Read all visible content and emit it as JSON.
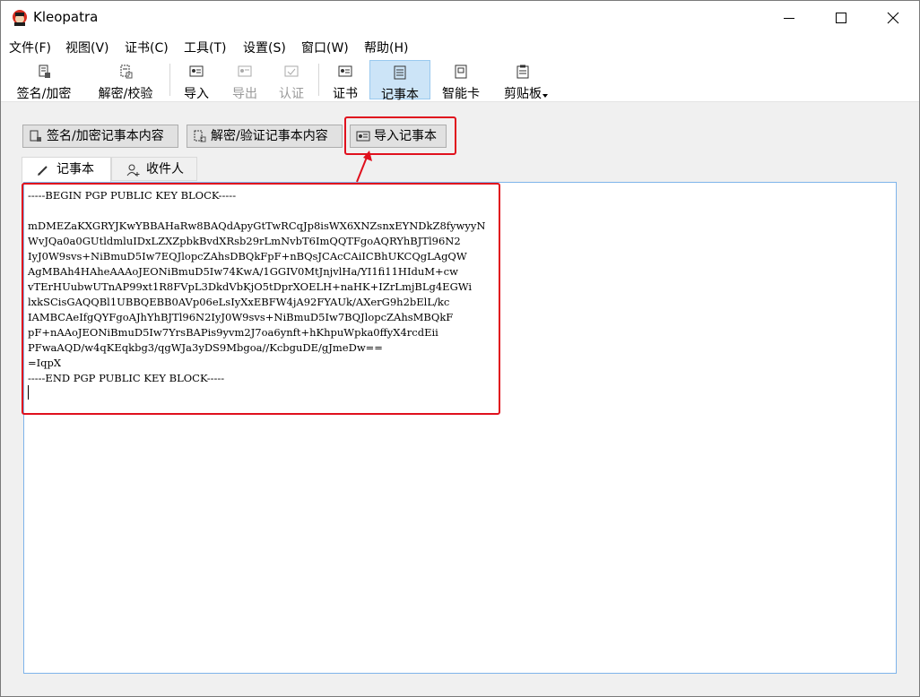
{
  "window": {
    "title": "Kleopatra",
    "controls": {
      "minimize": "minimize-icon",
      "maximize": "maximize-icon",
      "close": "close-icon"
    }
  },
  "menu": [
    "文件(F)",
    "视图(V)",
    "证书(C)",
    "工具(T)",
    "设置(S)",
    "窗口(W)",
    "帮助(H)"
  ],
  "toolbar": {
    "sign_encrypt": "签名/加密",
    "decrypt_verify": "解密/校验",
    "import": "导入",
    "export": "导出",
    "certify": "认证",
    "certificates": "证书",
    "notepad": "记事本",
    "smartcard": "智能卡",
    "clipboard": "剪贴板"
  },
  "notepad": {
    "sign_encrypt_button": "签名/加密记事本内容",
    "decrypt_verify_button": "解密/验证记事本内容",
    "import_button": "导入记事本",
    "tabs": {
      "notepad": "记事本",
      "recipients": "收件人"
    },
    "content": "-----BEGIN PGP PUBLIC KEY BLOCK-----\n\nmDMEZaKXGRYJKwYBBAHaRw8BAQdApyGtTwRCqJp8isWX6XNZsnxEYNDkZ8fywyyN\nWvJQa0a0GUtldmluIDxLZXZpbkBvdXRsb29rLmNvbT6ImQQTFgoAQRYhBJTl96N2\nIyJ0W9svs+NiBmuD5Iw7EQJlopcZAhsDBQkFpF+nBQsJCAcCAiICBhUKCQgLAgQW\nAgMBAh4HAheAAAoJEONiBmuD5Iw74KwA/1GGIV0MtJnjvlHa/YI1fi11HIduM+cw\nvTErHUubwUTnAP99xt1R8FVpL3DkdVbKjO5tDprXOELH+naHK+IZrLmjBLg4EGWi\nlxkSCisGAQQBl1UBBQEBB0AVp06eLsIyXxEBFW4jA92FYAUk/AXerG9h2bElL/kc\nIAMBCAeIfgQYFgoAJhYhBJTl96N2IyJ0W9svs+NiBmuD5Iw7BQJlopcZAhsMBQkF\npF+nAAoJEONiBmuD5Iw7YrsBAPis9yvm2J7oa6ynft+hKhpuWpka0ffyX4rcdEii\nPFwaAQD/w4qKEqkbg3/qgWJa3yDS9Mbgoa//KcbguDE/gJmeDw==\n=IqpX\n-----END PGP PUBLIC KEY BLOCK-----"
  },
  "colors": {
    "highlight": "#e0101d",
    "active_tool": "#cce4f7",
    "editor_border": "#7eb4ea"
  }
}
